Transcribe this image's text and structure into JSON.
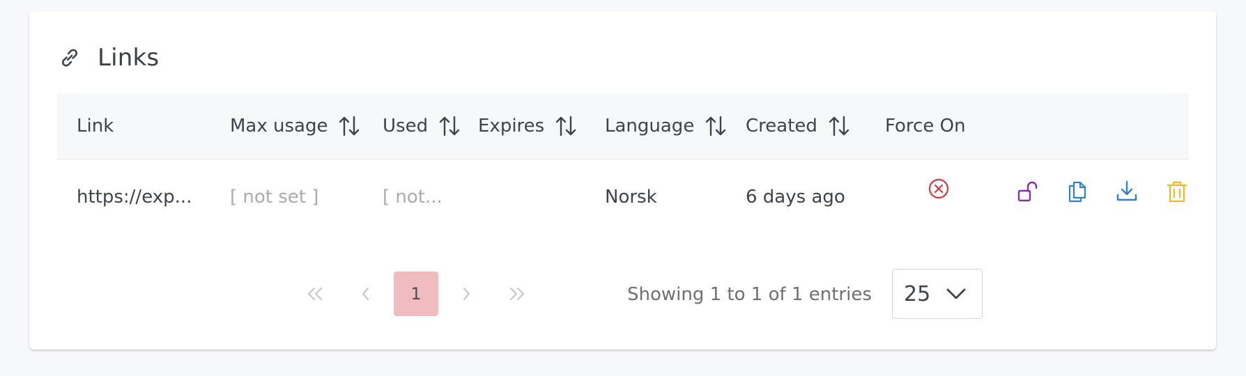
{
  "card": {
    "title": "Links",
    "title_icon": "link-icon"
  },
  "table": {
    "columns": [
      {
        "label": "Link",
        "sortable": false
      },
      {
        "label": "Max usage",
        "sortable": true
      },
      {
        "label": "Used",
        "sortable": true
      },
      {
        "label": "Expires",
        "sortable": true
      },
      {
        "label": "Language",
        "sortable": true
      },
      {
        "label": "Created",
        "sortable": true
      },
      {
        "label": "Force On",
        "sortable": false
      }
    ],
    "rows": [
      {
        "link": "https://exp...",
        "max_usage": "[ not set ]",
        "used": "[ not...",
        "expires": "",
        "language": "Norsk",
        "created": "6 days ago",
        "force_on_icon": "x-circle-icon",
        "actions": [
          {
            "icon": "unlock-icon",
            "color": "#8e2aa8"
          },
          {
            "icon": "copy-icon",
            "color": "#2f7fcf"
          },
          {
            "icon": "download-icon",
            "color": "#2f7fcf"
          },
          {
            "icon": "trash-icon",
            "color": "#f2b824"
          }
        ]
      }
    ]
  },
  "pagination": {
    "first": "«",
    "prev": "‹",
    "current": "1",
    "next": "›",
    "last": "»",
    "summary": "Showing 1 to 1 of 1 entries"
  },
  "page_size": {
    "value": "25"
  },
  "colors": {
    "force_off": "#d33a3f",
    "current_page_bg": "#f1bcbf"
  }
}
